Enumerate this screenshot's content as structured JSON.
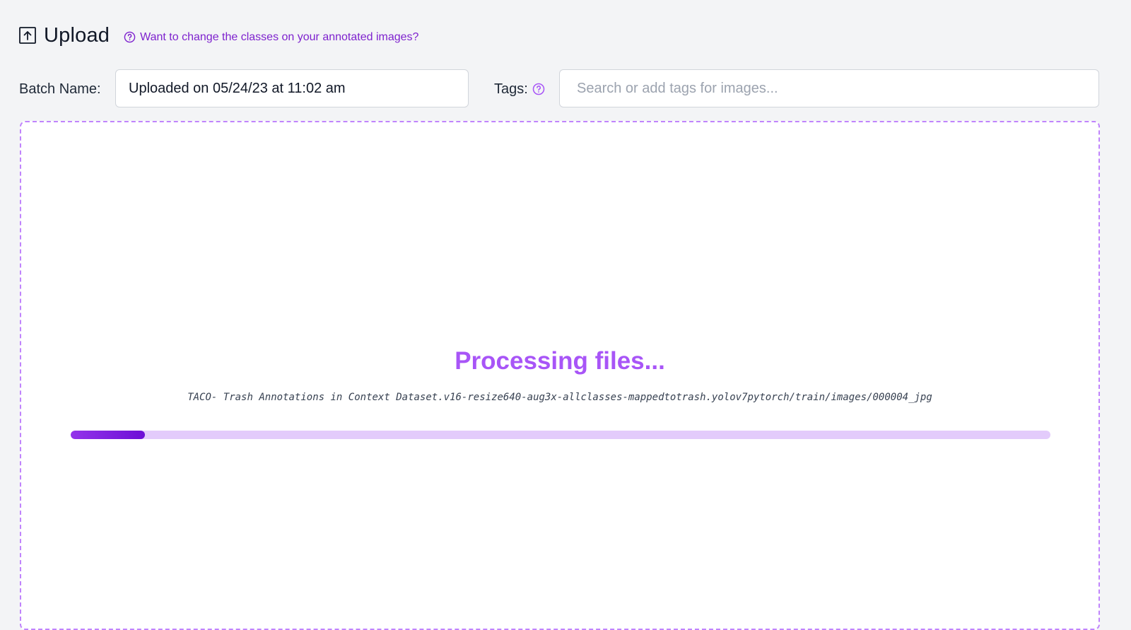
{
  "header": {
    "icon": "upload-icon",
    "title": "Upload",
    "help_icon": "question-circle-icon",
    "help_link_text": "Want to change the classes on your annotated images?"
  },
  "form": {
    "batch_label": "Batch Name:",
    "batch_value": "Uploaded on 05/24/23 at 11:02 am",
    "tags_label": "Tags:",
    "tags_help_icon": "question-circle-icon",
    "tags_placeholder": "Search or add tags for images..."
  },
  "upload_area": {
    "status_title": "Processing files...",
    "current_file": "TACO- Trash Annotations in Context Dataset.v16-resize640-aug3x-allclasses-mappedtotrash.yolov7pytorch/train/images/000004_jpg",
    "progress_fraction": 0.076
  },
  "colors": {
    "accent": "#a855f7",
    "link": "#7e22ce",
    "progress_fill": "#7c18e0",
    "progress_track": "#e3cbfb",
    "background": "#f3f4f6"
  }
}
